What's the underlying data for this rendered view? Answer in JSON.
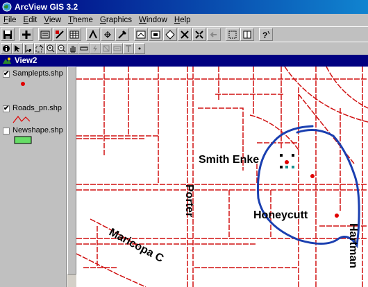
{
  "app": {
    "title": "ArcView GIS 3.2"
  },
  "menu": [
    "File",
    "Edit",
    "View",
    "Theme",
    "Graphics",
    "Window",
    "Help"
  ],
  "toolbar_buttons": [
    "save-icon",
    "add-theme-icon",
    "theme-properties-icon",
    "edit-legend-icon",
    "open-table-icon",
    "find-icon",
    "locate-address-icon",
    "query-builder-icon",
    "zoom-full-icon",
    "zoom-active-icon",
    "zoom-selected-icon",
    "zoom-in-fixed-icon",
    "zoom-out-fixed-icon",
    "zoom-previous-icon",
    "select-graphics-icon",
    "clear-selected-icon",
    "help-icon"
  ],
  "tools": [
    "identify-icon",
    "pointer-icon",
    "vertex-edit-icon",
    "select-feature-icon",
    "zoom-in-icon",
    "zoom-out-icon",
    "pan-icon",
    "measure-icon",
    "hotlink-icon",
    "area-of-interest-icon",
    "label-icon",
    "text-icon",
    "draw-point-icon"
  ],
  "view": {
    "title": "View2"
  },
  "themes": [
    {
      "name": "Samplepts.shp",
      "checked": true,
      "symbol": "point",
      "color": "#e00000"
    },
    {
      "name": "Roads_pn.shp",
      "checked": true,
      "symbol": "line",
      "color": "#e00000"
    },
    {
      "name": "Newshape.shp",
      "checked": false,
      "symbol": "polygon",
      "color": "#66dd66"
    }
  ],
  "map": {
    "labels": [
      "Smith Enke",
      "Porter",
      "Honeycutt",
      "Maricopa C",
      "Hartman"
    ],
    "road_color": "#d01010",
    "point_color": "#e00000",
    "sketch_color": "#1a3fb0"
  }
}
